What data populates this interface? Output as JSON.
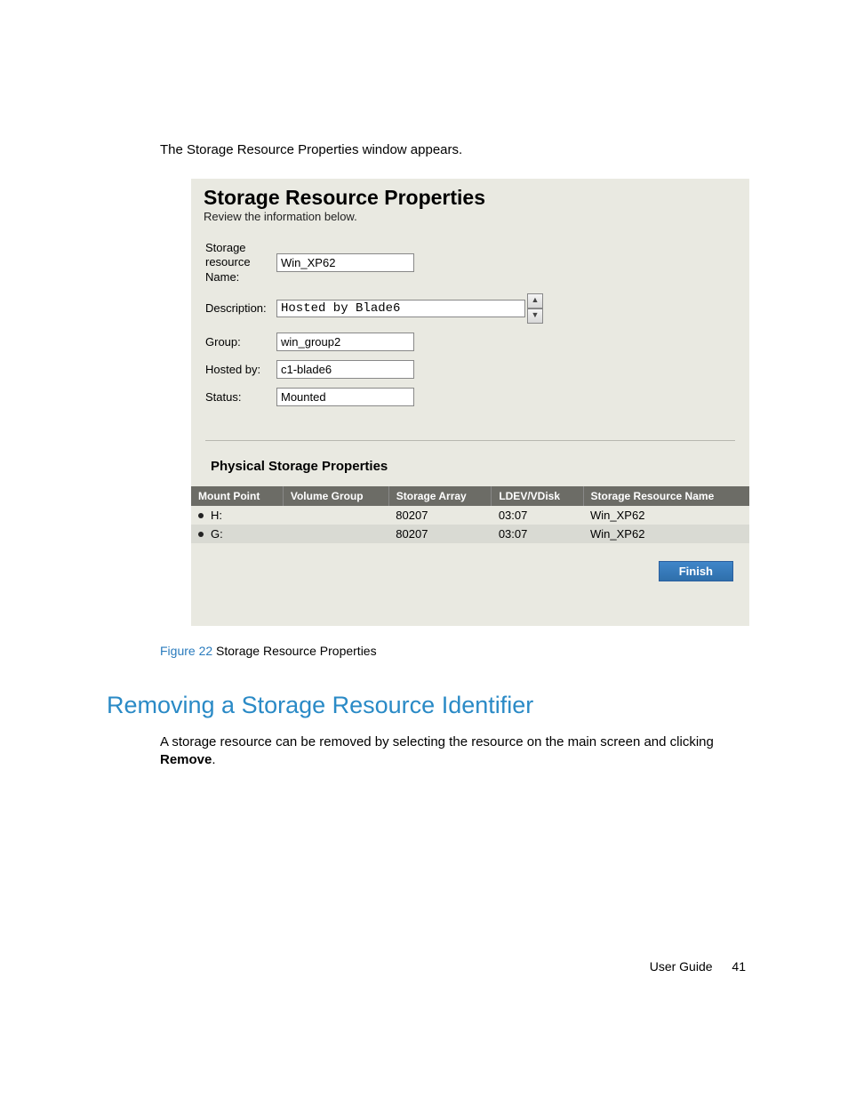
{
  "intro": "The Storage Resource Properties window appears.",
  "window": {
    "title": "Storage Resource Properties",
    "subtitle": "Review the information below.",
    "fields": {
      "name_label": "Storage resource Name:",
      "name_value": "Win_XP62",
      "desc_label": "Description:",
      "desc_value": "Hosted by Blade6",
      "group_label": "Group:",
      "group_value": "win_group2",
      "host_label": "Hosted by:",
      "host_value": "c1-blade6",
      "status_label": "Status:",
      "status_value": "Mounted"
    },
    "phys_title": "Physical Storage Properties",
    "table": {
      "headers": [
        "Mount Point",
        "Volume Group",
        "Storage Array",
        "LDEV/VDisk",
        "Storage Resource Name"
      ],
      "rows": [
        {
          "mount": "H:",
          "vg": "",
          "array": "80207",
          "ldev": "03:07",
          "srn": "Win_XP62"
        },
        {
          "mount": "G:",
          "vg": "",
          "array": "80207",
          "ldev": "03:07",
          "srn": "Win_XP62"
        }
      ]
    },
    "finish_label": "Finish"
  },
  "figure": {
    "label": "Figure 22",
    "caption": "Storage Resource Properties"
  },
  "section": {
    "heading": "Removing a Storage Resource Identifier",
    "body_before": "A storage resource can be removed by selecting the resource on the main screen and clicking ",
    "body_strong": "Remove",
    "body_after": "."
  },
  "footer": {
    "doc": "User Guide",
    "page": "41"
  }
}
